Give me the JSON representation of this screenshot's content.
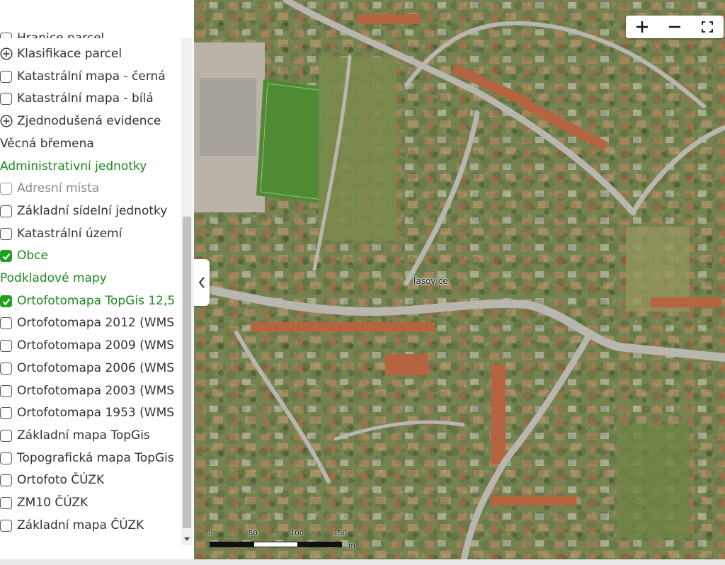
{
  "layers": {
    "partial_top": "Hranice parcel",
    "items": [
      {
        "label": "Klasifikace parcel",
        "kind": "expand"
      },
      {
        "label": "Katastrální mapa - černá",
        "kind": "checkbox",
        "checked": false
      },
      {
        "label": "Katastrální mapa - bílá",
        "kind": "checkbox",
        "checked": false
      },
      {
        "label": "Zjednodušená evidence",
        "kind": "expand"
      },
      {
        "label": "Věcná břemena",
        "kind": "text"
      },
      {
        "label": "Administrativní jednotky",
        "kind": "heading"
      },
      {
        "label": "Adresní místa",
        "kind": "checkbox",
        "checked": false,
        "disabled": true
      },
      {
        "label": "Základní sídelní jednotky",
        "kind": "checkbox",
        "checked": false
      },
      {
        "label": "Katastrální území",
        "kind": "checkbox",
        "checked": false
      },
      {
        "label": "Obce",
        "kind": "checkbox",
        "checked": true
      },
      {
        "label": "Podkladové mapy",
        "kind": "heading"
      },
      {
        "label": "Ortofotomapa TopGis 12,5",
        "kind": "checkbox",
        "checked": true
      },
      {
        "label": "Ortofotomapa 2012 (WMS",
        "kind": "checkbox",
        "checked": false
      },
      {
        "label": "Ortofotomapa 2009 (WMS",
        "kind": "checkbox",
        "checked": false
      },
      {
        "label": "Ortofotomapa 2006 (WMS",
        "kind": "checkbox",
        "checked": false
      },
      {
        "label": "Ortofotomapa 2003 (WMS",
        "kind": "checkbox",
        "checked": false
      },
      {
        "label": "Ortofotomapa 1953 (WMS",
        "kind": "checkbox",
        "checked": false
      },
      {
        "label": "Základní mapa TopGis",
        "kind": "checkbox",
        "checked": false
      },
      {
        "label": "Topografická mapa TopGis",
        "kind": "checkbox",
        "checked": false
      },
      {
        "label": "Ortofoto ČÚZK",
        "kind": "checkbox",
        "checked": false
      },
      {
        "label": "ZM10 ČÚZK",
        "kind": "checkbox",
        "checked": false
      },
      {
        "label": "Základní mapa ČÚZK",
        "kind": "checkbox",
        "checked": false
      }
    ]
  },
  "map": {
    "place_label": "Tasovice",
    "scale": {
      "ticks": [
        "0",
        "50",
        "100",
        "150"
      ],
      "unit": "m"
    },
    "controls": {
      "zoom_in": "+",
      "zoom_out": "−",
      "fullscreen": "fullscreen-icon"
    }
  },
  "colors": {
    "accent_green": "#1b8a1b",
    "check_green": "#1fa31f"
  }
}
